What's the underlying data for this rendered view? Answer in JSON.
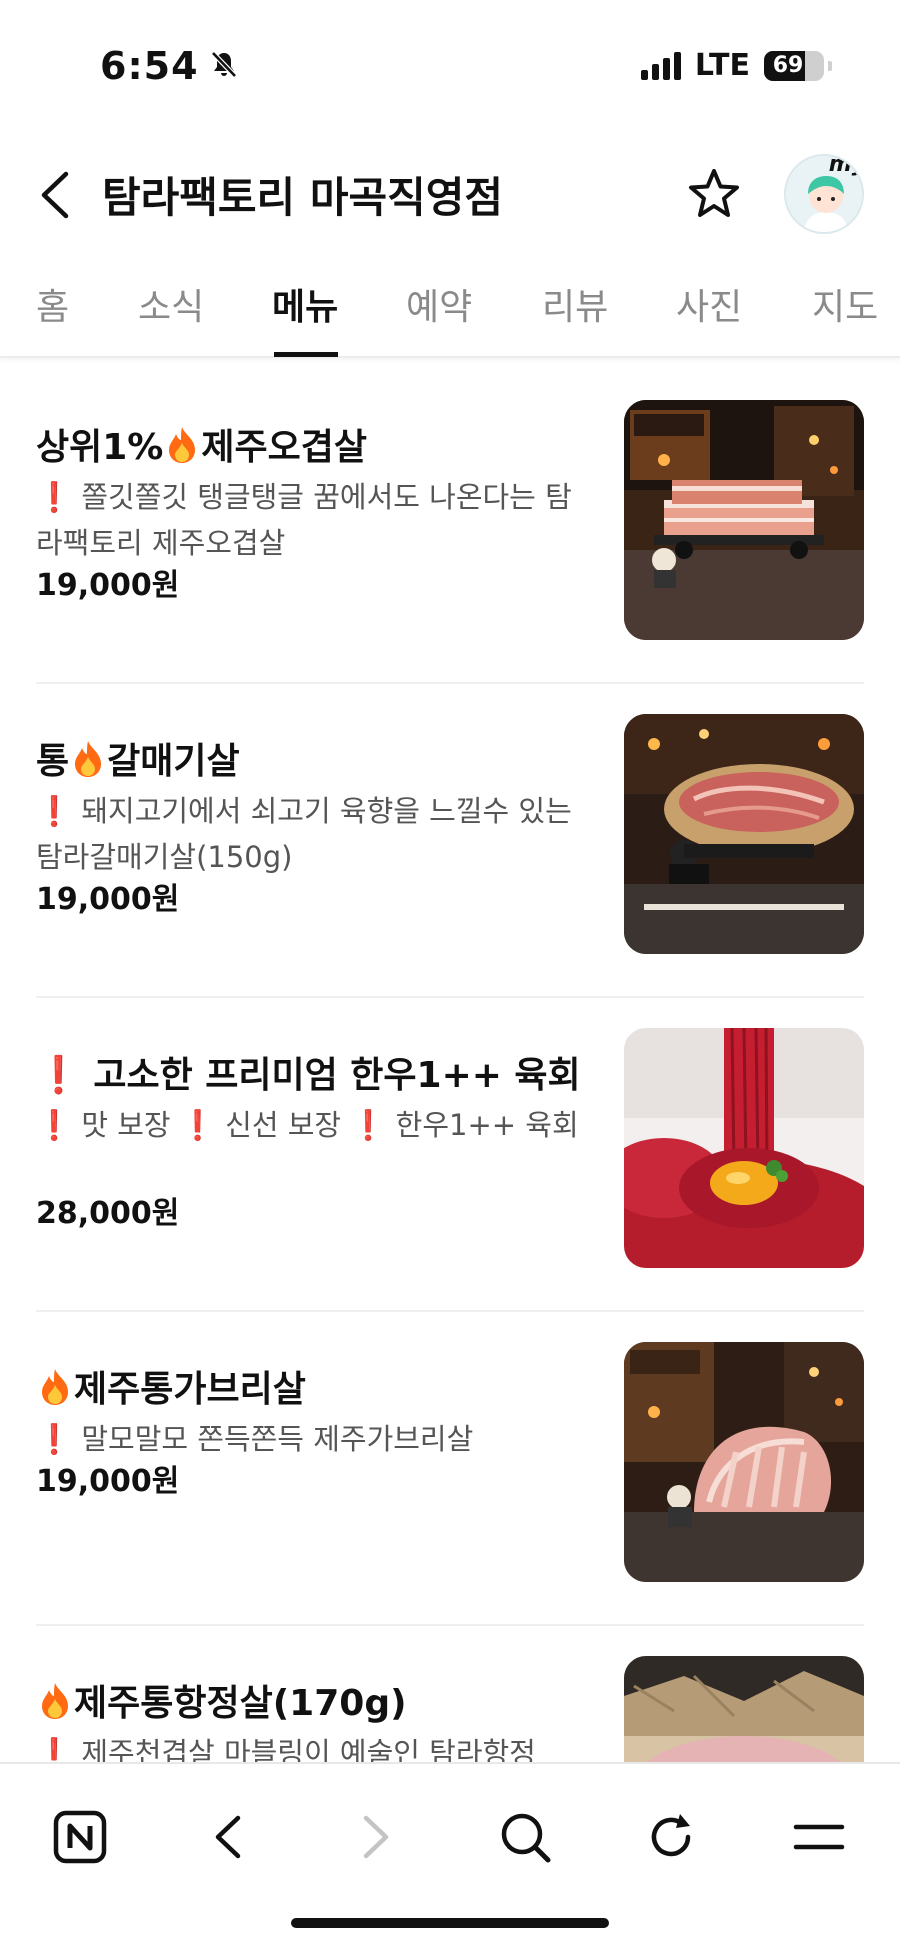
{
  "status": {
    "time": "6:54",
    "network": "LTE",
    "battery": "69",
    "battery_level": 0.69
  },
  "header": {
    "title": "탐라팩토리 마곡직영점",
    "my_label": "my"
  },
  "tabs": [
    {
      "label": "홈"
    },
    {
      "label": "소식"
    },
    {
      "label": "메뉴"
    },
    {
      "label": "예약"
    },
    {
      "label": "리뷰"
    },
    {
      "label": "사진"
    },
    {
      "label": "지도"
    }
  ],
  "active_tab": "메뉴",
  "menu": [
    {
      "name_prefix": "상위1%",
      "name_suffix": "제주오겹살",
      "desc": "쫄깃쫄깃 탱글탱글 꿈에서도 나온다는 탐라팩토리 제주오겹살",
      "price": "19,000원",
      "image_icon": "pork-belly-food-photo"
    },
    {
      "name_prefix": "통",
      "name_suffix": "갈매기살",
      "desc": "돼지고기에서 쇠고기 육향을 느낄수 있는 탐라갈매기살(150g)",
      "price": "19,000원",
      "image_icon": "galmaegisal-food-photo"
    },
    {
      "name_prefix": "",
      "name_suffix": "고소한 프리미엄 한우1++ 육회",
      "desc_parts": [
        "맛 보장",
        "신선 보장",
        "한우1++ 육회"
      ],
      "price": "28,000원",
      "image_icon": "beef-tartare-food-photo"
    },
    {
      "name_prefix": "",
      "name_suffix": "제주통가브리살",
      "desc": "말모말모 쫀득쫀득 제주가브리살",
      "price": "19,000원",
      "image_icon": "gabrisal-food-photo"
    },
    {
      "name_prefix": "",
      "name_suffix": "제주통항정살(170g)",
      "desc": "제주천겹살 마블링이 예술인 탐라항정",
      "image_icon": "hangjeongsal-food-photo"
    }
  ],
  "toolbar": {
    "icons": [
      "naver-home-icon",
      "back-icon",
      "forward-icon",
      "search-icon",
      "refresh-icon",
      "menu-icon"
    ]
  },
  "colors": {
    "accent_red": "#d9172b",
    "fire_orange": "#ff7a1a",
    "text_dark": "#111111",
    "text_muted": "#555555",
    "tab_inactive": "#8a8a8a"
  }
}
